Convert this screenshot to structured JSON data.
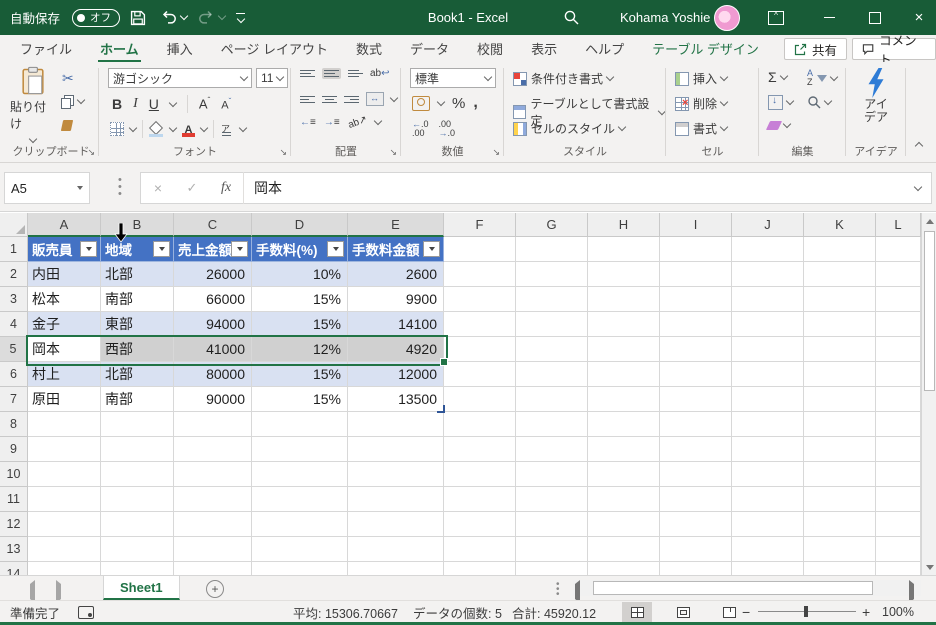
{
  "titlebar": {
    "autosave_label": "自動保存",
    "autosave_state": "オフ",
    "title": "Book1  -  Excel",
    "user_name": "Kohama Yoshie"
  },
  "menu": {
    "tabs": [
      {
        "label": "ファイル"
      },
      {
        "label": "ホーム",
        "active": true
      },
      {
        "label": "挿入"
      },
      {
        "label": "ページ レイアウト"
      },
      {
        "label": "数式"
      },
      {
        "label": "データ"
      },
      {
        "label": "校閲"
      },
      {
        "label": "表示"
      },
      {
        "label": "ヘルプ"
      },
      {
        "label": "テーブル デザイン",
        "contextual": true
      }
    ],
    "share_label": "共有",
    "comment_label": "コメント"
  },
  "ribbon": {
    "clipboard": {
      "label": "クリップボード",
      "paste_label": "貼り付け"
    },
    "font": {
      "label": "フォント",
      "font_name": "游ゴシック",
      "font_size": "11"
    },
    "alignment": {
      "label": "配置"
    },
    "number": {
      "label": "数値",
      "format": "標準"
    },
    "styles": {
      "label": "スタイル",
      "conditional": "条件付き書式",
      "format_as_table": "テーブルとして書式設定",
      "cell_styles": "セルのスタイル"
    },
    "cells": {
      "label": "セル",
      "insert": "挿入",
      "delete": "削除",
      "format": "書式"
    },
    "editing": {
      "label": "編集"
    },
    "ideas": {
      "label": "アイデア",
      "button_label": "アイデア"
    }
  },
  "formula_bar": {
    "name_box": "A5",
    "value": "岡本"
  },
  "grid": {
    "column_letters": [
      "A",
      "B",
      "C",
      "D",
      "E",
      "F",
      "G",
      "H",
      "I",
      "J",
      "K",
      "L"
    ],
    "row_count": 14,
    "selected_range": "A5:E5",
    "active_cell": "A5"
  },
  "table": {
    "headers": [
      "販売員",
      "地域",
      "売上金額",
      "手数料(%)",
      "手数料金額"
    ],
    "rows": [
      [
        "内田",
        "北部",
        "26000",
        "10%",
        "2600"
      ],
      [
        "松本",
        "南部",
        "66000",
        "15%",
        "9900"
      ],
      [
        "金子",
        "東部",
        "94000",
        "15%",
        "14100"
      ],
      [
        "岡本",
        "西部",
        "41000",
        "12%",
        "4920"
      ],
      [
        "村上",
        "北部",
        "80000",
        "15%",
        "12000"
      ],
      [
        "原田",
        "南部",
        "90000",
        "15%",
        "13500"
      ]
    ]
  },
  "sheet_bar": {
    "sheet_name": "Sheet1"
  },
  "status_bar": {
    "mode": "準備完了",
    "average": "平均: 15306.70667",
    "count": "データの個数: 5",
    "sum": "合計: 45920.12",
    "zoom_level": "100%"
  },
  "colors": {
    "title_green": "#185C37",
    "accent_green": "#217346",
    "table_header_blue": "#4472C4",
    "band_blue": "#D9E1F2",
    "selection_gray": "#D0D0D0"
  }
}
